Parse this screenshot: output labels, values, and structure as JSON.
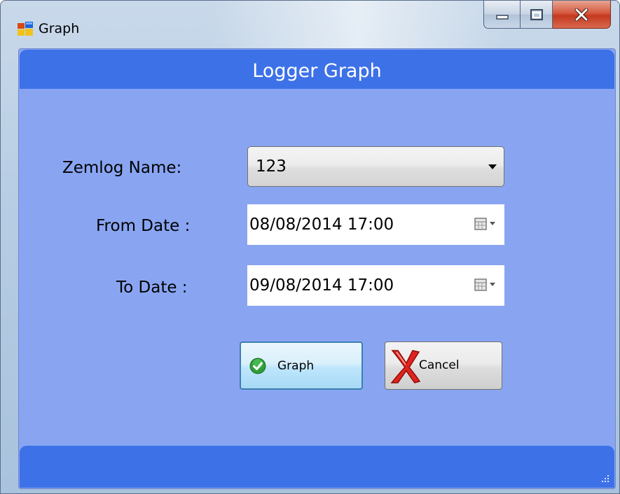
{
  "window": {
    "title": "Graph",
    "icon": "app-window-icon",
    "caption_buttons": [
      "minimize-icon",
      "maximize-icon",
      "close-icon"
    ]
  },
  "form": {
    "title": "Logger Graph",
    "zemlog_label": "Zemlog Name:",
    "zemlog_value": "123",
    "from_label": "From Date :",
    "from_value": "08/08/2014 17:00",
    "to_label": "To Date :",
    "to_value": "09/08/2014 17:00"
  },
  "buttons": {
    "graph_label": "Graph",
    "graph_icon": "check-icon",
    "cancel_label": "Cancel",
    "cancel_icon": "red-x-icon"
  },
  "colors": {
    "client_bg": "#89a5f2",
    "band": "#3d71e8",
    "title_text": "#ffffff"
  }
}
